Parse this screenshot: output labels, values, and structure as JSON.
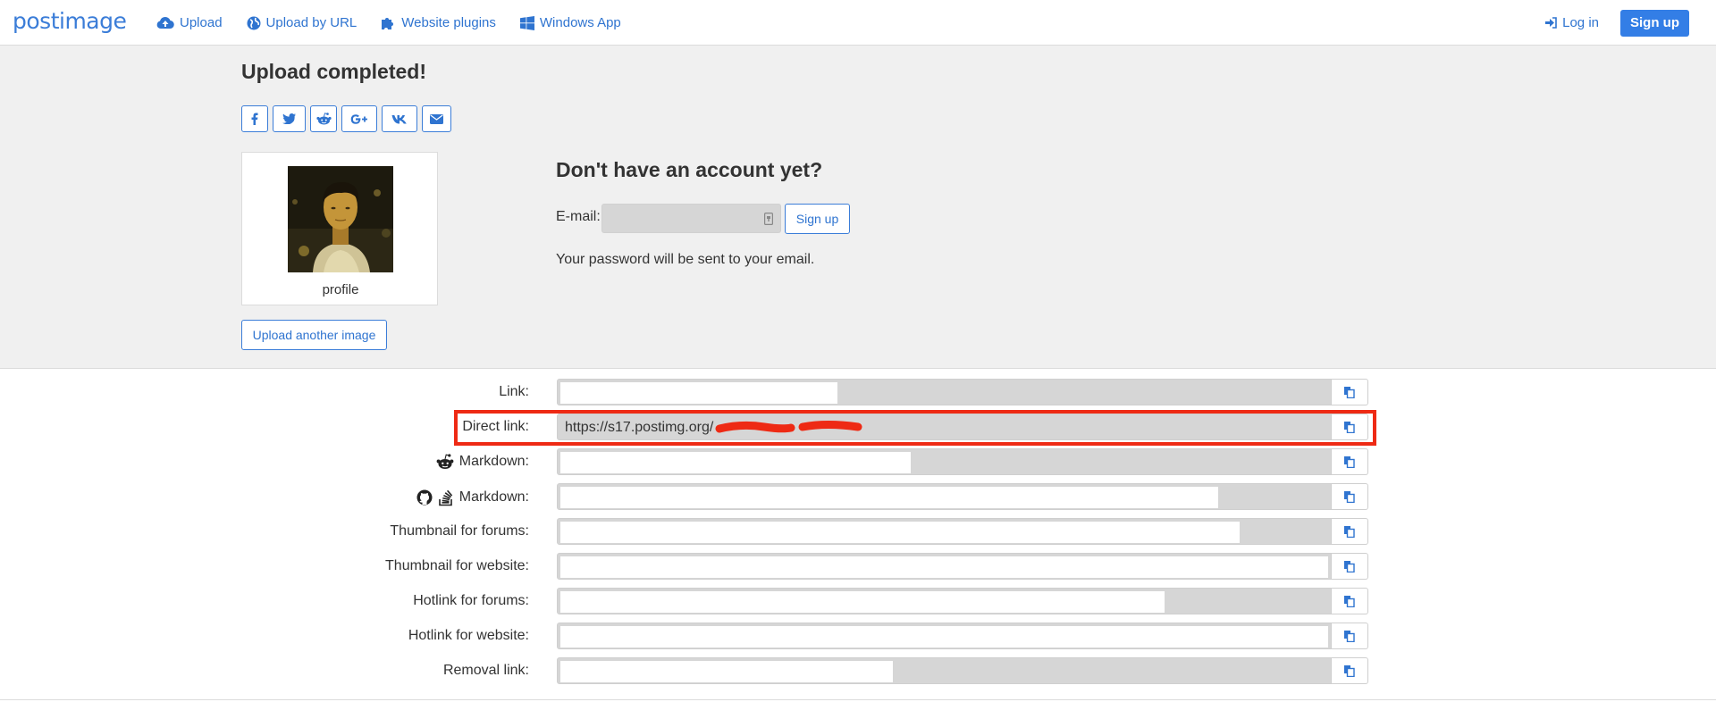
{
  "nav": {
    "logo": "postimage",
    "links": [
      {
        "label": "Upload",
        "icon": "cloud-upload-icon"
      },
      {
        "label": "Upload by URL",
        "icon": "globe-icon"
      },
      {
        "label": "Website plugins",
        "icon": "puzzle-icon"
      },
      {
        "label": "Windows App",
        "icon": "windows-icon"
      }
    ],
    "login": "Log in",
    "signup": "Sign up"
  },
  "upload": {
    "title": "Upload completed!",
    "share_icons": [
      "facebook-icon",
      "twitter-icon",
      "reddit-icon",
      "google-plus-icon",
      "vk-icon",
      "envelope-icon"
    ],
    "share_labels": [
      "f",
      "",
      "",
      "G+",
      "vk",
      ""
    ],
    "thumbnail_caption": "profile",
    "upload_another": "Upload another image"
  },
  "account": {
    "title": "Don't have an account yet?",
    "email_label": "E-mail:",
    "email_value": "",
    "signup_button": "Sign up",
    "note": "Your password will be sent to your email."
  },
  "links": [
    {
      "label": "Link:",
      "value": "",
      "icon": ""
    },
    {
      "label": "Direct link:",
      "value": "https://s17.postimg.org/",
      "highlighted": true
    },
    {
      "label": "Markdown:",
      "value": "",
      "icon": "reddit-icon"
    },
    {
      "label": "Markdown:",
      "value": "",
      "icon": "github-stackoverflow-icon"
    },
    {
      "label": "Thumbnail for forums:",
      "value": ""
    },
    {
      "label": "Thumbnail for website:",
      "value": ""
    },
    {
      "label": "Hotlink for forums:",
      "value": ""
    },
    {
      "label": "Hotlink for website:",
      "value": ""
    },
    {
      "label": "Removal link:",
      "value": ""
    }
  ],
  "colors": {
    "accent": "#337ee6",
    "highlight": "#ee2a14",
    "band": "#f0f0f0",
    "field": "#d6d6d6"
  }
}
